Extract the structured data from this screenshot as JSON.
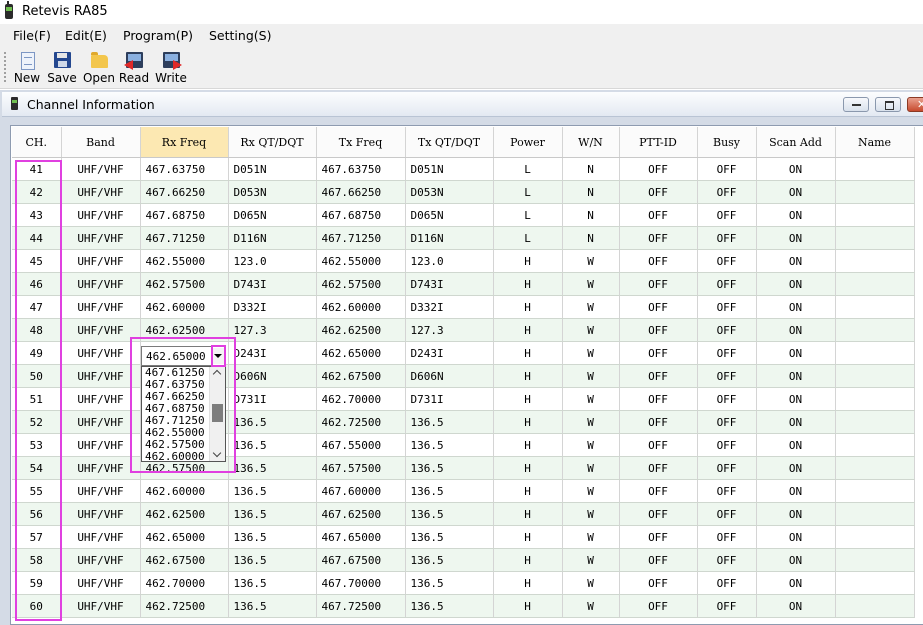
{
  "window": {
    "title": "Retevis RA85"
  },
  "menu": [
    "File(F)",
    "Edit(E)",
    "Program(P)",
    "Setting(S)"
  ],
  "toolbar": [
    {
      "label": "New",
      "icon": "new-file-icon"
    },
    {
      "label": "Save",
      "icon": "floppy-disk-icon"
    },
    {
      "label": "Open",
      "icon": "folder-icon"
    },
    {
      "label": "Read",
      "icon": "read-radio-icon"
    },
    {
      "label": "Write",
      "icon": "write-radio-icon"
    }
  ],
  "child_window": {
    "title": "Channel Information"
  },
  "grid": {
    "columns": [
      "CH.",
      "Band",
      "Rx Freq",
      "Rx QT/DQT",
      "Tx Freq",
      "Tx QT/DQT",
      "Power",
      "W/N",
      "PTT-ID",
      "Busy",
      "Scan Add",
      "Name"
    ],
    "selected_column": "Rx Freq",
    "rows": [
      [
        "41",
        "UHF/VHF",
        "467.63750",
        "D051N",
        "467.63750",
        "D051N",
        "L",
        "N",
        "OFF",
        "OFF",
        "ON",
        ""
      ],
      [
        "42",
        "UHF/VHF",
        "467.66250",
        "D053N",
        "467.66250",
        "D053N",
        "L",
        "N",
        "OFF",
        "OFF",
        "ON",
        ""
      ],
      [
        "43",
        "UHF/VHF",
        "467.68750",
        "D065N",
        "467.68750",
        "D065N",
        "L",
        "N",
        "OFF",
        "OFF",
        "ON",
        ""
      ],
      [
        "44",
        "UHF/VHF",
        "467.71250",
        "D116N",
        "467.71250",
        "D116N",
        "L",
        "N",
        "OFF",
        "OFF",
        "ON",
        ""
      ],
      [
        "45",
        "UHF/VHF",
        "462.55000",
        "123.0",
        "462.55000",
        "123.0",
        "H",
        "W",
        "OFF",
        "OFF",
        "ON",
        ""
      ],
      [
        "46",
        "UHF/VHF",
        "462.57500",
        "D743I",
        "462.57500",
        "D743I",
        "H",
        "W",
        "OFF",
        "OFF",
        "ON",
        ""
      ],
      [
        "47",
        "UHF/VHF",
        "462.60000",
        "D332I",
        "462.60000",
        "D332I",
        "H",
        "W",
        "OFF",
        "OFF",
        "ON",
        ""
      ],
      [
        "48",
        "UHF/VHF",
        "462.62500",
        "127.3",
        "462.62500",
        "127.3",
        "H",
        "W",
        "OFF",
        "OFF",
        "ON",
        ""
      ],
      [
        "49",
        "UHF/VHF",
        "",
        "D243I",
        "462.65000",
        "D243I",
        "H",
        "W",
        "OFF",
        "OFF",
        "ON",
        ""
      ],
      [
        "50",
        "UHF/VHF",
        "",
        "D606N",
        "462.67500",
        "D606N",
        "H",
        "W",
        "OFF",
        "OFF",
        "ON",
        ""
      ],
      [
        "51",
        "UHF/VHF",
        "",
        "D731I",
        "462.70000",
        "D731I",
        "H",
        "W",
        "OFF",
        "OFF",
        "ON",
        ""
      ],
      [
        "52",
        "UHF/VHF",
        "",
        "136.5",
        "462.72500",
        "136.5",
        "H",
        "W",
        "OFF",
        "OFF",
        "ON",
        ""
      ],
      [
        "53",
        "UHF/VHF",
        "",
        "136.5",
        "467.55000",
        "136.5",
        "H",
        "W",
        "OFF",
        "OFF",
        "ON",
        ""
      ],
      [
        "54",
        "UHF/VHF",
        "462.57500",
        "136.5",
        "467.57500",
        "136.5",
        "H",
        "W",
        "OFF",
        "OFF",
        "ON",
        ""
      ],
      [
        "55",
        "UHF/VHF",
        "462.60000",
        "136.5",
        "467.60000",
        "136.5",
        "H",
        "W",
        "OFF",
        "OFF",
        "ON",
        ""
      ],
      [
        "56",
        "UHF/VHF",
        "462.62500",
        "136.5",
        "467.62500",
        "136.5",
        "H",
        "W",
        "OFF",
        "OFF",
        "ON",
        ""
      ],
      [
        "57",
        "UHF/VHF",
        "462.65000",
        "136.5",
        "467.65000",
        "136.5",
        "H",
        "W",
        "OFF",
        "OFF",
        "ON",
        ""
      ],
      [
        "58",
        "UHF/VHF",
        "462.67500",
        "136.5",
        "467.67500",
        "136.5",
        "H",
        "W",
        "OFF",
        "OFF",
        "ON",
        ""
      ],
      [
        "59",
        "UHF/VHF",
        "462.70000",
        "136.5",
        "467.70000",
        "136.5",
        "H",
        "W",
        "OFF",
        "OFF",
        "ON",
        ""
      ],
      [
        "60",
        "UHF/VHF",
        "462.72500",
        "136.5",
        "467.72500",
        "136.5",
        "H",
        "W",
        "OFF",
        "OFF",
        "ON",
        ""
      ]
    ]
  },
  "combo": {
    "row_ch": "49",
    "value": "462.65000",
    "options": [
      "467.61250",
      "467.63750",
      "467.66250",
      "467.68750",
      "467.71250",
      "462.55000",
      "462.57500",
      "462.60000"
    ]
  },
  "colors": {
    "highlight": "#e040e0",
    "selected_header": "#fce8b2",
    "row_alt": "#eef7ef"
  }
}
